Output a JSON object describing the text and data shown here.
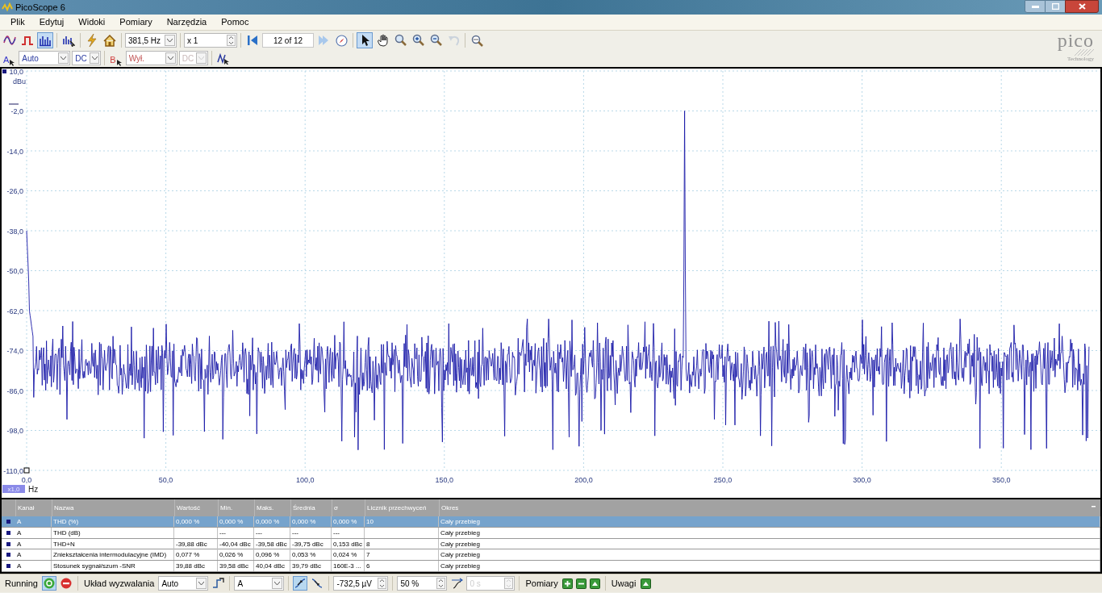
{
  "window": {
    "title": "PicoScope 6"
  },
  "menu": [
    "Plik",
    "Edytuj",
    "Widoki",
    "Pomiary",
    "Narzędzia",
    "Pomoc"
  ],
  "toolbar": {
    "view_modes": [
      {
        "kind": "scope",
        "selected": false
      },
      {
        "kind": "persistence",
        "selected": false
      },
      {
        "kind": "spectrum",
        "selected": true
      }
    ],
    "frequency": "381,5 Hz",
    "zoom": "x 1",
    "buffer": "12 of 12",
    "tools": [
      {
        "kind": "pointer",
        "selected": true
      },
      {
        "kind": "hand",
        "selected": false
      },
      {
        "kind": "zoom",
        "selected": false
      },
      {
        "kind": "zoom-in",
        "selected": false
      },
      {
        "kind": "zoom-out",
        "selected": false
      },
      {
        "kind": "undo",
        "selected": false,
        "disabled": true
      }
    ]
  },
  "logo": {
    "name": "pico",
    "tagline": "Technology"
  },
  "channels": [
    {
      "label": "A",
      "color": "#3232c8",
      "range": "Auto",
      "coupling": "DC",
      "coupling_disabled": false
    },
    {
      "label": "B",
      "color": "#d03c3c",
      "range": "Wył.",
      "coupling": "DC",
      "coupling_disabled": true
    }
  ],
  "chart": {
    "y_unit": "dBu",
    "y_ticks": [
      "10,0",
      "-2,0",
      "-14,0",
      "-26,0",
      "-38,0",
      "-50,0",
      "-62,0",
      "-74,0",
      "-86,0",
      "-98,0",
      "-110,0"
    ],
    "x_ticks": [
      "0,0",
      "50,0",
      "100,0",
      "150,0",
      "200,0",
      "250,0",
      "300,0",
      "350,0"
    ],
    "x_unit": "Hz",
    "zoom_badge": "x1,0"
  },
  "measurements": {
    "columns": [
      "Kanał",
      "Nazwa",
      "Wartość",
      "Min.",
      "Maks.",
      "Średnia",
      "σ",
      "Licznik przechwyceń",
      "Okres"
    ],
    "rows": [
      {
        "selected": true,
        "cells": [
          "A",
          "THD (%)",
          "0,000 %",
          "0,000 %",
          "0,000 %",
          "0,000 %",
          "0,000 %",
          "10",
          "Cały przebieg"
        ]
      },
      {
        "selected": false,
        "cells": [
          "A",
          "THD (dB)",
          "",
          "---",
          "---",
          "---",
          "---",
          "",
          "Cały przebieg"
        ]
      },
      {
        "selected": false,
        "cells": [
          "A",
          "THD+N",
          "-39,88 dBc",
          "-40,04 dBc",
          "-39,58 dBc",
          "-39,75 dBc",
          "0,153 dBc",
          "8",
          "Cały przebieg"
        ]
      },
      {
        "selected": false,
        "cells": [
          "A",
          "Zniekształcenia intermodulacyjne (IMD)",
          "0,077 %",
          "0,026 %",
          "0,096 %",
          "0,053 %",
          "0,024 %",
          "7",
          "Cały przebieg"
        ]
      },
      {
        "selected": false,
        "cells": [
          "A",
          "Stosunek sygnał/szum -SNR",
          "39,88 dBc",
          "39,58 dBc",
          "40,04 dBc",
          "39,79 dBc",
          "160E-3 ...",
          "6",
          "Cały przebieg"
        ]
      }
    ]
  },
  "status_bar": {
    "state": "Running",
    "running": true,
    "trigger_label": "Układ wyzwalania",
    "trigger_mode": "Auto",
    "trigger_source": "A",
    "rising_edge_selected": true,
    "falling_edge_selected": false,
    "threshold": "-732,5 µV",
    "pretrigger": "50 %",
    "delay": "0 s",
    "delay_disabled": true,
    "measurements_label": "Pomiary",
    "notes_label": "Uwagi"
  }
}
